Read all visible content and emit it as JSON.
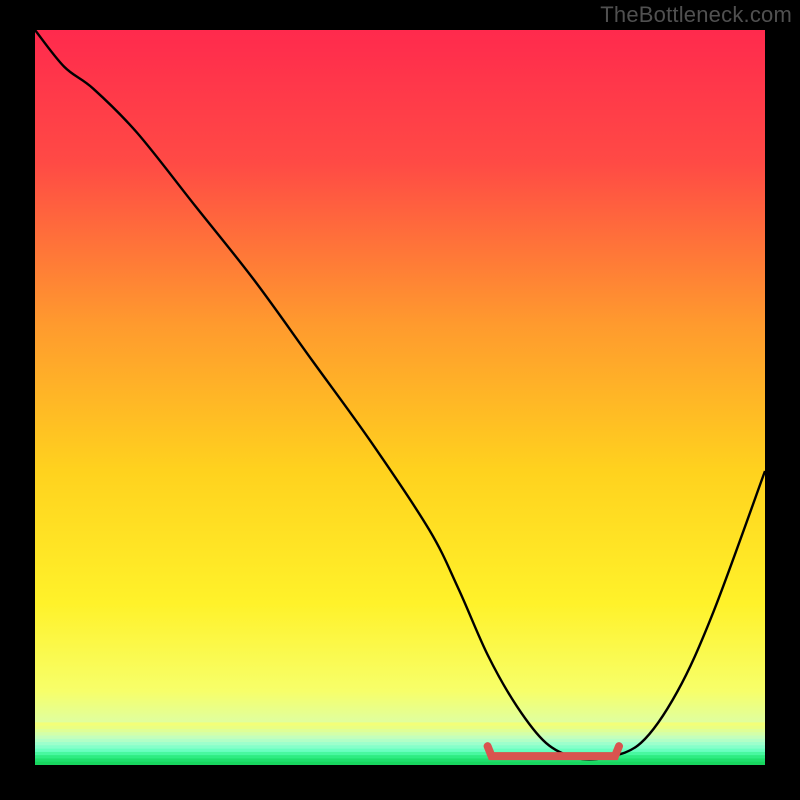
{
  "watermark": "TheBottleneck.com",
  "colors": {
    "frame": "#000000",
    "curve": "#000000",
    "marker": "#d9544f",
    "gradient_stops": [
      {
        "offset": 0.0,
        "color": "#ff2a4d"
      },
      {
        "offset": 0.18,
        "color": "#ff4a45"
      },
      {
        "offset": 0.4,
        "color": "#ff9a2e"
      },
      {
        "offset": 0.6,
        "color": "#ffd21e"
      },
      {
        "offset": 0.78,
        "color": "#fff22a"
      },
      {
        "offset": 0.9,
        "color": "#f7ff6a"
      },
      {
        "offset": 0.955,
        "color": "#d8ffb0"
      },
      {
        "offset": 0.985,
        "color": "#96ffcf"
      },
      {
        "offset": 1.0,
        "color": "#1be56a"
      }
    ],
    "bottom_bands": [
      "#f3ff78",
      "#eaff83",
      "#dfff96",
      "#d3ffa9",
      "#c4ffbb",
      "#b2ffc6",
      "#9dffcc",
      "#85ffca",
      "#6affbf",
      "#48f8a0",
      "#2eec82",
      "#1fe06d",
      "#18d65f"
    ]
  },
  "chart_data": {
    "type": "line",
    "title": "",
    "xlabel": "",
    "ylabel": "",
    "xlim": [
      0,
      100
    ],
    "ylim": [
      0,
      100
    ],
    "series": [
      {
        "name": "bottleneck-curve",
        "x": [
          0,
          4,
          8,
          14,
          22,
          30,
          38,
          46,
          54,
          58,
          62,
          66,
          70,
          74,
          78,
          83,
          88,
          93,
          100
        ],
        "y": [
          100,
          95,
          92,
          86,
          76,
          66,
          55,
          44,
          32,
          24,
          15,
          8,
          3,
          1,
          1,
          3,
          10,
          21,
          40
        ]
      }
    ],
    "flat_region": {
      "x_start": 62,
      "x_end": 80,
      "y": 1.2
    },
    "annotations": []
  }
}
